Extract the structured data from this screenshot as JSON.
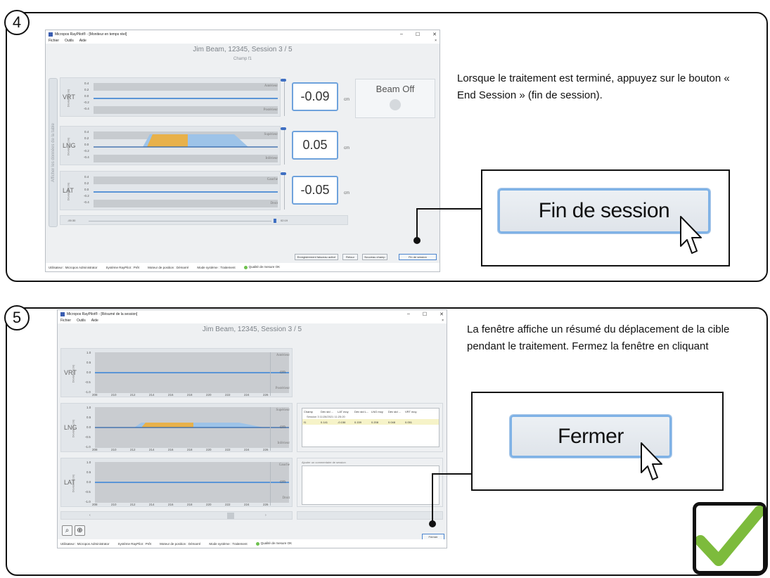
{
  "step4": {
    "badge": "4",
    "window_title": "Micropos RayPilot® - [Moniteur en temps réel]",
    "menu": [
      "Fichier",
      "Outils",
      "Aide"
    ],
    "close_x": "×",
    "session_title": "Jim Beam, 12345, Session 3 / 5",
    "champ": "Champ f1",
    "side_tab": "Afficher les données de la table",
    "ylabel": "Déviation (cm)",
    "ticks": [
      "0.4",
      "0.2",
      "0.0",
      "-0.2",
      "-0.4"
    ],
    "axes": [
      {
        "name": "VRT",
        "top_label": "Antérieur",
        "bottom_label": "Postérieur",
        "value": "-0.09",
        "unit": "cm"
      },
      {
        "name": "LNG",
        "top_label": "Supérieur",
        "bottom_label": "Inférieur",
        "value": "0.05",
        "unit": "cm"
      },
      {
        "name": "LAT",
        "top_label": "Gauche",
        "bottom_label": "Droit",
        "value": "-0.05",
        "unit": "cm"
      }
    ],
    "beam_status": "Beam Off",
    "time_start": "-00:30",
    "time_end": "02:19",
    "buttons": [
      "Enregistrement faisceau activé",
      "Retour",
      "Nouveau champ",
      "Fin de session"
    ],
    "status": [
      "Utilisateur : Micropos Administrator",
      "Système RayPilot : Prêt",
      "Moteur de position : Démarré",
      "Mode système : Traitement",
      "Qualité de mesure OK"
    ],
    "instruction": "Lorsque le traitement est terminé, appuyez sur le bouton « End Session » (fin de session).",
    "callout_button": "Fin de session",
    "accent": "#7fb2e6",
    "signal_color": "#e8b14a"
  },
  "step5": {
    "badge": "5",
    "window_title": "Micropos RayPilot® - [Résumé de la session]",
    "menu": [
      "Fichier",
      "Outils",
      "Aide"
    ],
    "close_x": "×",
    "session_title": "Jim Beam, 12345, Session 3 / 5",
    "ylabel": "Déviation (cm)",
    "ticks": [
      "1.0",
      "0.5",
      "0.0",
      "-0.5",
      "-1.0"
    ],
    "xticks": [
      "208",
      "210",
      "212",
      "214",
      "216",
      "218",
      "220",
      "222",
      "224",
      "226"
    ],
    "axes": [
      {
        "name": "VRT",
        "top_label": "Antérieur",
        "bottom_label": "Postérieur",
        "unit": "cm"
      },
      {
        "name": "LNG",
        "top_label": "Supérieur",
        "bottom_label": "Inférieur",
        "unit": "cm"
      },
      {
        "name": "LAT",
        "top_label": "Gauche",
        "bottom_label": "Droit",
        "unit": "cm"
      }
    ],
    "table": {
      "headers": [
        "Champ",
        "Dév std ...",
        "LAT moy",
        "Dév std L...",
        "LNG moy",
        "Dév std ...",
        "VRT moy"
      ],
      "session": "Session 3 11/26/2021 11:25:20",
      "row": [
        "f1",
        "0.141",
        "-0.156",
        "0.159",
        "0.208",
        "0.048",
        "0.051"
      ]
    },
    "comment_label": "Ajouter un commentaire de session",
    "button": "Fermer",
    "status": [
      "Utilisateur : Micropos Administrator",
      "Système RayPilot : Prêt",
      "Moteur de position : Démarré",
      "Mode système : Traitement",
      "Qualité de mesure OK"
    ],
    "instruction": "La fenêtre affiche un résumé du déplacement de la cible pendant le traitement. Fermez la fenêtre en cliquant",
    "callout_button": "Fermer",
    "check_color": "#7dbb3c"
  }
}
